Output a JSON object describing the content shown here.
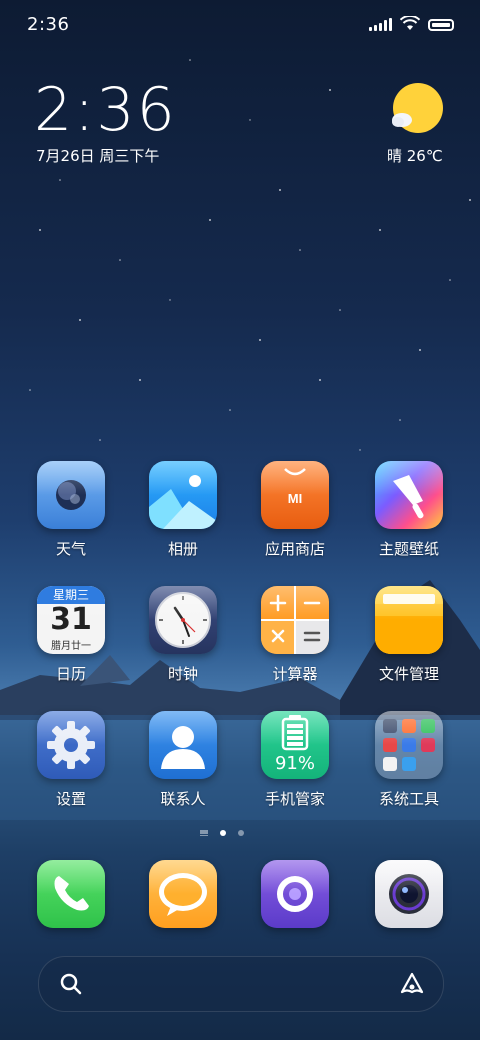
{
  "status_bar": {
    "time": "2:36"
  },
  "clock_widget": {
    "time": "2:36",
    "date": "7月26日 周三下午"
  },
  "weather_widget": {
    "condition_temp": "晴 26℃",
    "icon": "sun-with-cloud-icon"
  },
  "calendar_icon": {
    "weekday": "星期三",
    "day": "31",
    "lunar": "腊月廿一"
  },
  "security_icon": {
    "battery_percent": "91%",
    "battery_level": 0.91
  },
  "apps": [
    {
      "label": "天气",
      "icon": "weather-app-icon"
    },
    {
      "label": "相册",
      "icon": "gallery-app-icon"
    },
    {
      "label": "应用商店",
      "icon": "app-store-icon"
    },
    {
      "label": "主题壁纸",
      "icon": "themes-icon"
    },
    {
      "label": "日历",
      "icon": "calendar-app-icon"
    },
    {
      "label": "时钟",
      "icon": "clock-app-icon"
    },
    {
      "label": "计算器",
      "icon": "calculator-app-icon"
    },
    {
      "label": "文件管理",
      "icon": "file-manager-icon"
    },
    {
      "label": "设置",
      "icon": "settings-gear-icon"
    },
    {
      "label": "联系人",
      "icon": "contacts-icon"
    },
    {
      "label": "手机管家",
      "icon": "security-battery-icon"
    },
    {
      "label": "系统工具",
      "icon": "folder-icon"
    }
  ],
  "store_icon_text": "MI",
  "dock": [
    {
      "icon": "phone-icon"
    },
    {
      "icon": "messages-icon"
    },
    {
      "icon": "browser-icon"
    },
    {
      "icon": "camera-icon"
    }
  ],
  "pager": {
    "pages": 2,
    "active": 1
  },
  "search_bar": {
    "left_icon": "search-icon",
    "right_icon": "assistant-icon"
  }
}
